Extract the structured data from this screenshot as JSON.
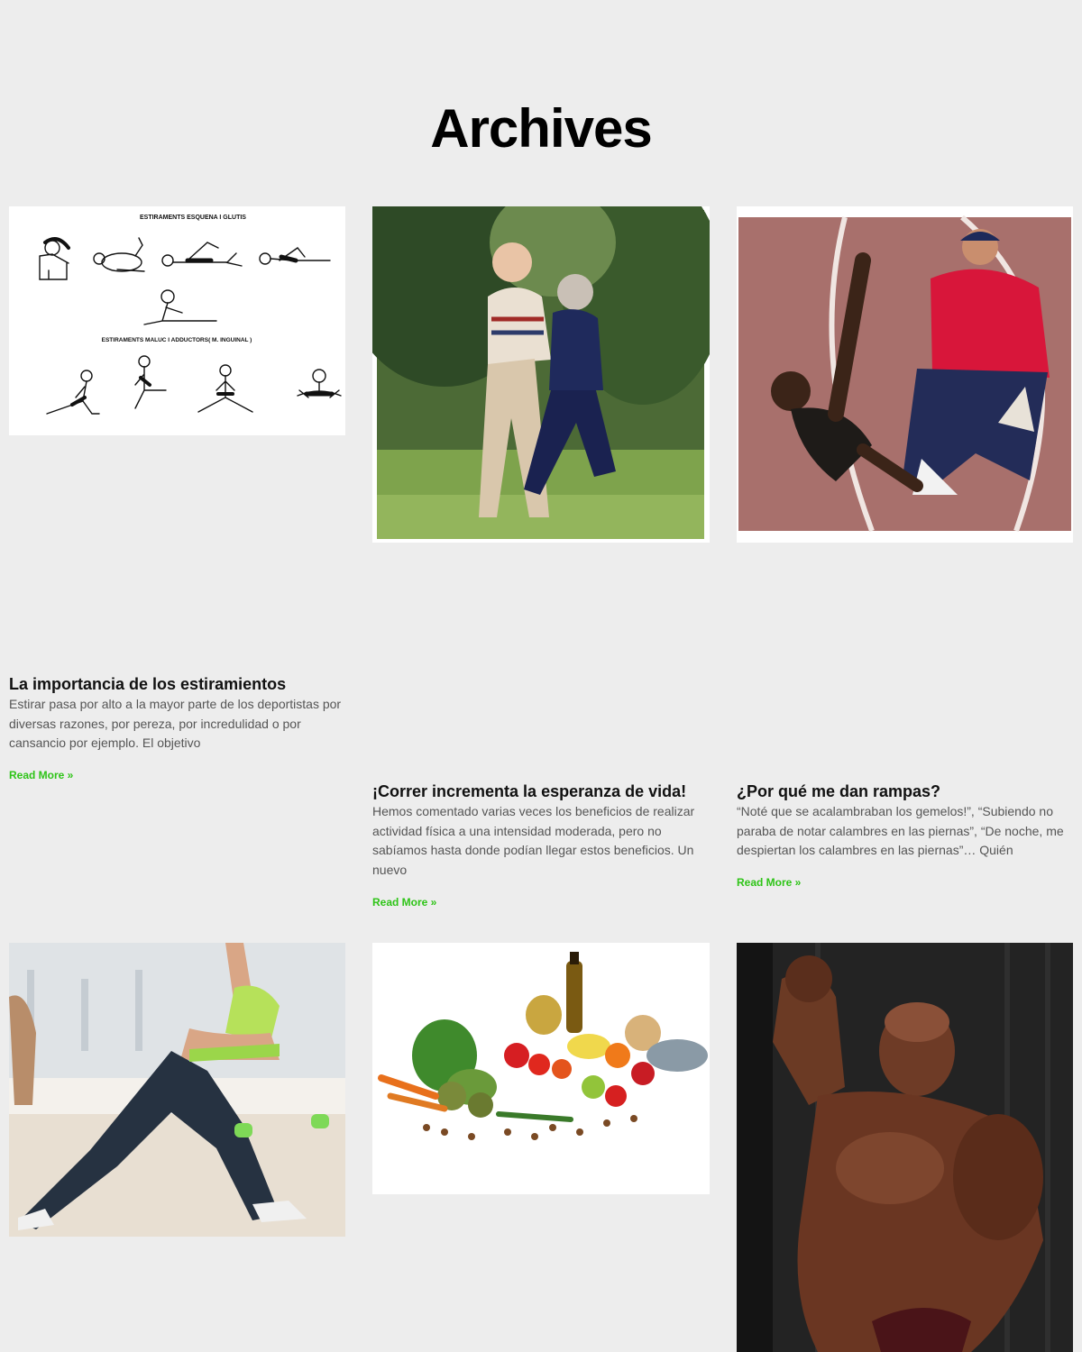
{
  "page": {
    "title": "Archives"
  },
  "posts": [
    {
      "title": "La importancia de los estiramientos",
      "excerpt": "Estirar pasa por alto a la mayor parte de los deportistas por diversas razones, por pereza, por incredulidad o por cansancio por ejemplo. El objetivo",
      "read_more": "Read More »",
      "image": {
        "label_top": "ESTIRAMENTS ESQUENA I GLUTIS",
        "label_bottom": "ESTIRAMENTS MALUC I ADDUCTORS( M. INGUINAL )"
      }
    },
    {
      "title": "¡Correr incrementa la esperanza de vida!",
      "excerpt": "Hemos comentado varias veces los beneficios de realizar actividad física a una intensidad moderada, pero no sabíamos hasta donde podían llegar estos beneficios. Un nuevo",
      "read_more": "Read More »"
    },
    {
      "title": "¿Por qué me dan rampas?",
      "excerpt": "“Noté que se acalambraban los gemelos!”, “Subiendo no paraba de notar calambres en las piernas”, “De noche, me despiertan los calambres en las piernas”… Quién",
      "read_more": "Read More »"
    },
    {},
    {},
    {}
  ],
  "colors": {
    "background": "#ededed",
    "accent": "#2ec417",
    "title": "#000000"
  }
}
